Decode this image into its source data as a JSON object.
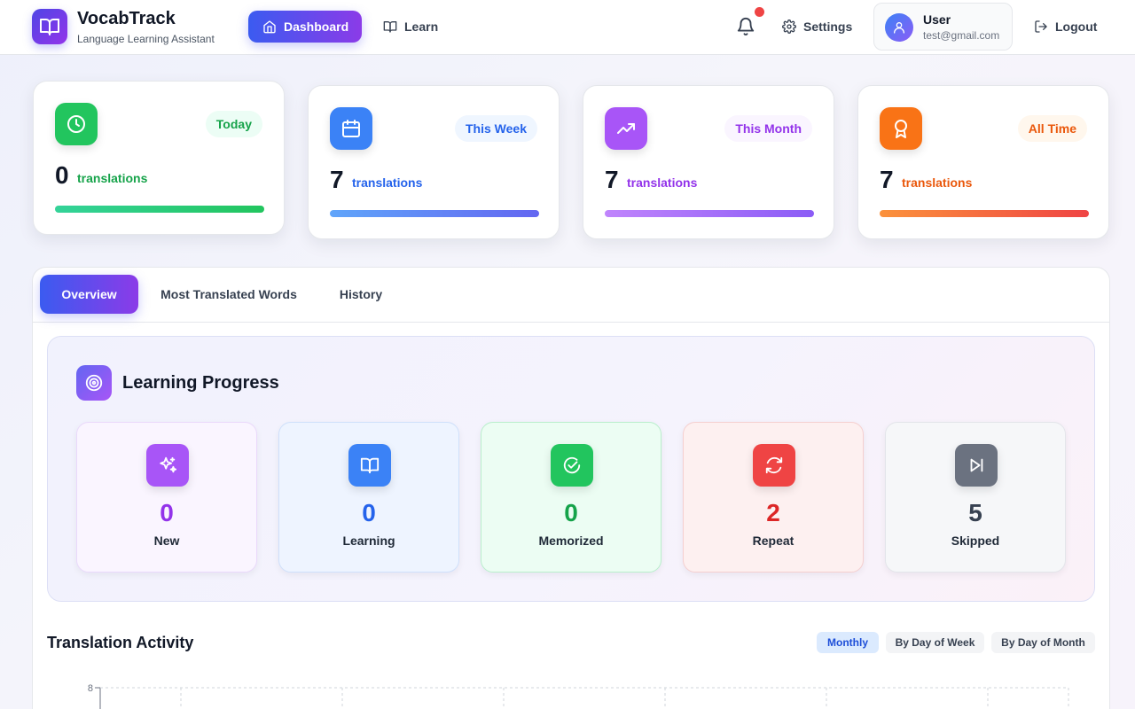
{
  "app": {
    "title": "VocabTrack",
    "subtitle": "Language Learning Assistant"
  },
  "nav": {
    "dashboard": "Dashboard",
    "learn": "Learn",
    "settings": "Settings",
    "logout": "Logout"
  },
  "user": {
    "name": "User",
    "email": "test@gmail.com"
  },
  "stats": [
    {
      "badge": "Today",
      "count": "0",
      "unit": "translations",
      "icon": "clock-icon",
      "color": "#16a34a"
    },
    {
      "badge": "This Week",
      "count": "7",
      "unit": "translations",
      "icon": "calendar-icon",
      "color": "#2563eb"
    },
    {
      "badge": "This Month",
      "count": "7",
      "unit": "translations",
      "icon": "trending-up-icon",
      "color": "#9333ea"
    },
    {
      "badge": "All Time",
      "count": "7",
      "unit": "translations",
      "icon": "award-icon",
      "color": "#ea580c"
    }
  ],
  "tabs": [
    {
      "label": "Overview",
      "active": true
    },
    {
      "label": "Most Translated Words",
      "active": false
    },
    {
      "label": "History",
      "active": false
    }
  ],
  "learning_progress": {
    "title": "Learning Progress",
    "items": [
      {
        "label": "New",
        "count": "0",
        "icon": "sparkles-icon",
        "color": "#9333ea"
      },
      {
        "label": "Learning",
        "count": "0",
        "icon": "book-open-icon",
        "color": "#2563eb"
      },
      {
        "label": "Memorized",
        "count": "0",
        "icon": "check-circle-icon",
        "color": "#16a34a"
      },
      {
        "label": "Repeat",
        "count": "2",
        "icon": "refresh-icon",
        "color": "#dc2626"
      },
      {
        "label": "Skipped",
        "count": "5",
        "icon": "skip-forward-icon",
        "color": "#374151"
      }
    ]
  },
  "activity": {
    "title": "Translation Activity",
    "modes": [
      {
        "label": "Monthly",
        "active": true
      },
      {
        "label": "By Day of Week",
        "active": false
      },
      {
        "label": "By Day of Month",
        "active": false
      }
    ]
  },
  "chart_data": {
    "type": "bar",
    "y_ticks": [
      "8"
    ],
    "ylim": [
      0,
      8
    ]
  }
}
